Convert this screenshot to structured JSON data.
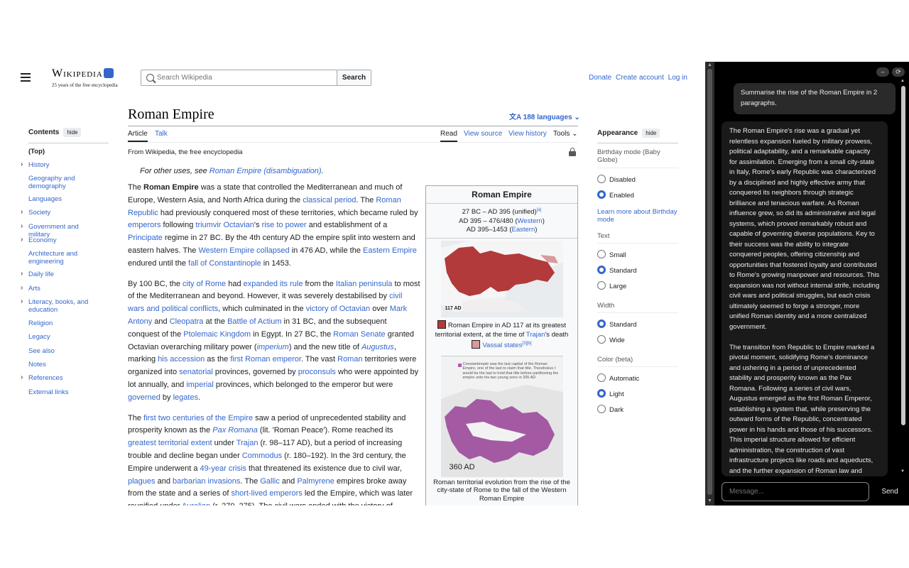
{
  "header": {
    "logo_text": "Wikipedia",
    "tagline": "25 years of the free encyclopedia",
    "search_placeholder": "Search Wikipedia",
    "search_button": "Search",
    "links": [
      "Donate",
      "Create account",
      "Log in"
    ]
  },
  "toc": {
    "title": "Contents",
    "hide": "hide",
    "items": [
      {
        "label": "(Top)",
        "expandable": false
      },
      {
        "label": "History",
        "expandable": true
      },
      {
        "label": "Geography and demography",
        "expandable": false
      },
      {
        "label": "Languages",
        "expandable": false
      },
      {
        "label": "Society",
        "expandable": true
      },
      {
        "label": "Government and military",
        "expandable": true
      },
      {
        "label": "Economy",
        "expandable": true
      },
      {
        "label": "Architecture and engineering",
        "expandable": false
      },
      {
        "label": "Daily life",
        "expandable": true
      },
      {
        "label": "Arts",
        "expandable": true
      },
      {
        "label": "Literacy, books, and education",
        "expandable": true
      },
      {
        "label": "Religion",
        "expandable": false
      },
      {
        "label": "Legacy",
        "expandable": false
      },
      {
        "label": "See also",
        "expandable": false
      },
      {
        "label": "Notes",
        "expandable": false
      },
      {
        "label": "References",
        "expandable": true
      },
      {
        "label": "External links",
        "expandable": false
      }
    ]
  },
  "article": {
    "title": "Roman Empire",
    "languages": "188 languages",
    "tabs_left": [
      "Article",
      "Talk"
    ],
    "tabs_right": [
      "Read",
      "View source",
      "View history",
      "Tools"
    ],
    "from": "From Wikipedia, the free encyclopedia",
    "hatnote_prefix": "For other uses, see ",
    "hatnote_link": "Roman Empire (disambiguation)",
    "hatnote_suffix": ".",
    "p1": [
      {
        "t": "The "
      },
      {
        "t": "Roman Empire",
        "b": true
      },
      {
        "t": " was a state that controlled the Mediterranean and much of Europe, Western Asia, and North Africa during the "
      },
      {
        "t": "classical period",
        "l": true
      },
      {
        "t": ". The "
      },
      {
        "t": "Roman Republic",
        "l": true
      },
      {
        "t": " had previously conquered most of these territories, which became ruled by "
      },
      {
        "t": "emperors",
        "l": true
      },
      {
        "t": " following "
      },
      {
        "t": "triumvir Octavian",
        "l": true
      },
      {
        "t": "'s "
      },
      {
        "t": "rise to power",
        "l": true
      },
      {
        "t": " and establishment of a "
      },
      {
        "t": "Principate",
        "l": true
      },
      {
        "t": " regime in 27 BC. By the 4th century AD the empire split into western and eastern halves. The "
      },
      {
        "t": "Western Empire collapsed",
        "l": true
      },
      {
        "t": " in 476 AD, while the "
      },
      {
        "t": "Eastern Empire",
        "l": true
      },
      {
        "t": " endured until the "
      },
      {
        "t": "fall of Constantinople",
        "l": true
      },
      {
        "t": " in 1453."
      }
    ],
    "p2": [
      {
        "t": "By 100 BC, the "
      },
      {
        "t": "city of Rome",
        "l": true
      },
      {
        "t": " had "
      },
      {
        "t": "expanded its rule",
        "l": true
      },
      {
        "t": " from the "
      },
      {
        "t": "Italian peninsula",
        "l": true
      },
      {
        "t": " to most of the Mediterranean and beyond. However, it was severely destabilised by "
      },
      {
        "t": "civil wars and political conflicts",
        "l": true
      },
      {
        "t": ", which culminated in the "
      },
      {
        "t": "victory of Octavian",
        "l": true
      },
      {
        "t": " over "
      },
      {
        "t": "Mark Antony",
        "l": true
      },
      {
        "t": " and "
      },
      {
        "t": "Cleopatra",
        "l": true
      },
      {
        "t": " at the "
      },
      {
        "t": "Battle of Actium",
        "l": true
      },
      {
        "t": " in 31 BC, and the subsequent conquest of the "
      },
      {
        "t": "Ptolemaic Kingdom",
        "l": true
      },
      {
        "t": " in Egypt. In 27 BC, the "
      },
      {
        "t": "Roman Senate",
        "l": true
      },
      {
        "t": " granted Octavian overarching military power ("
      },
      {
        "t": "imperium",
        "l": true,
        "i": true
      },
      {
        "t": ") and the new title of "
      },
      {
        "t": "Augustus",
        "l": true,
        "i": true
      },
      {
        "t": ", marking "
      },
      {
        "t": "his accession",
        "l": true
      },
      {
        "t": " as the "
      },
      {
        "t": "first Roman emperor",
        "l": true
      },
      {
        "t": ". The vast "
      },
      {
        "t": "Roman",
        "l": true
      },
      {
        "t": " territories were organized into "
      },
      {
        "t": "senatorial",
        "l": true
      },
      {
        "t": " provinces, governed by "
      },
      {
        "t": "proconsuls",
        "l": true
      },
      {
        "t": " who were appointed by lot annually, and "
      },
      {
        "t": "imperial",
        "l": true
      },
      {
        "t": " provinces, which belonged to the emperor but were "
      },
      {
        "t": "governed",
        "l": true
      },
      {
        "t": " by "
      },
      {
        "t": "legates",
        "l": true
      },
      {
        "t": "."
      }
    ],
    "p3": [
      {
        "t": "The "
      },
      {
        "t": "first two centuries of the Empire",
        "l": true
      },
      {
        "t": " saw a period of unprecedented stability and prosperity known as the "
      },
      {
        "t": "Pax Romana",
        "l": true,
        "i": true
      },
      {
        "t": " ("
      },
      {
        "t": "lit.",
        "l": false
      },
      {
        "t": " 'Roman Peace'). Rome reached its "
      },
      {
        "t": "greatest territorial extent",
        "l": true
      },
      {
        "t": " under "
      },
      {
        "t": "Trajan",
        "l": true
      },
      {
        "t": " (r. 98–117 AD), but a period of increasing trouble and decline began under "
      },
      {
        "t": "Commodus",
        "l": true
      },
      {
        "t": " (r. 180–192). In the 3rd century, the Empire underwent a "
      },
      {
        "t": "49-year crisis",
        "l": true
      },
      {
        "t": " that threatened its existence due to civil war, "
      },
      {
        "t": "plagues",
        "l": true
      },
      {
        "t": " and "
      },
      {
        "t": "barbarian invasions",
        "l": true
      },
      {
        "t": ". The "
      },
      {
        "t": "Gallic",
        "l": true
      },
      {
        "t": " and "
      },
      {
        "t": "Palmyrene",
        "l": true
      },
      {
        "t": " empires broke away from the state and a series of "
      },
      {
        "t": "short-lived emperors",
        "l": true
      },
      {
        "t": " led the Empire, which was later reunified under "
      },
      {
        "t": "Aurelian",
        "l": true
      },
      {
        "t": " (r. 270–275). The civil wars ended with the victory of"
      }
    ]
  },
  "infobox": {
    "title": "Roman Empire",
    "date1": "27 BC – AD 395 (unified)",
    "date1_ref": "[a]",
    "date2_prefix": "AD 395 – 476/480 (",
    "date2_link": "Western",
    "date2_suffix": ")",
    "date3_prefix": "AD 395–1453 (",
    "date3_link": "Eastern",
    "date3_suffix": ")",
    "map1_label": "117 AD",
    "cap1_line1": "Roman Empire in AD 117 at its greatest territorial extent, at the time of ",
    "cap1_link": "Trajan",
    "cap1_suffix": "'s death",
    "vassal": "Vassal states",
    "vassal_ref": "[3][b]",
    "map2_note": "Constantinople was the last capital of the Roman Empire, one of the last to claim that title. Theodosius I would be the last to hold that title before partitioning the empire unto his two young sons in 395 AD",
    "map2_year": "360 AD",
    "cap2": "Roman territorial evolution from the rise of the city-state of Rome to the fall of the Western Roman Empire",
    "colors": {
      "empire": "#b23a3a",
      "vassal": "#d89a9a",
      "evolution": "#a35aa3"
    }
  },
  "appearance": {
    "title": "Appearance",
    "hide": "hide",
    "birthday_label": "Birthday mode (Baby Globe)",
    "birthday_options": [
      "Disabled",
      "Enabled"
    ],
    "birthday_selected": "Enabled",
    "learn_more": "Learn more about Birthday mode",
    "text_label": "Text",
    "text_options": [
      "Small",
      "Standard",
      "Large"
    ],
    "text_selected": "Standard",
    "width_label": "Width",
    "width_options": [
      "Standard",
      "Wide"
    ],
    "width_selected": "Standard",
    "color_label": "Color (beta)",
    "color_options": [
      "Automatic",
      "Light",
      "Dark"
    ],
    "color_selected": "Light"
  },
  "chat": {
    "user_message": "Summarise the rise of the Roman Empire in 2 paragraphs.",
    "reply_p1": "The Roman Empire's rise was a gradual yet relentless expansion fueled by military prowess, political adaptability, and a remarkable capacity for assimilation. Emerging from a small city-state in Italy, Rome's early Republic was characterized by a disciplined and highly effective army that conquered its neighbors through strategic brilliance and tenacious warfare. As Roman influence grew, so did its administrative and legal systems, which proved remarkably robust and capable of governing diverse populations. Key to their success was the ability to integrate conquered peoples, offering citizenship and opportunities that fostered loyalty and contributed to Rome's growing manpower and resources. This expansion was not without internal strife, including civil wars and political struggles, but each crisis ultimately seemed to forge a stronger, more unified Roman identity and a more centralized government.",
    "reply_p2": "The transition from Republic to Empire marked a pivotal moment, solidifying Rome's dominance and ushering in a period of unprecedented stability and prosperity known as the Pax Romana. Following a series of civil wars, Augustus emerged as the first Roman Emperor, establishing a system that, while preserving the outward forms of the Republic, concentrated power in his hands and those of his successors. This imperial structure allowed for efficient administration, the construction of vast infrastructure projects like roads and aqueducts, and the further expansion of Roman law and",
    "input_placeholder": "Message...",
    "send_label": "Send",
    "minimize": "–",
    "refresh": "⟳"
  }
}
